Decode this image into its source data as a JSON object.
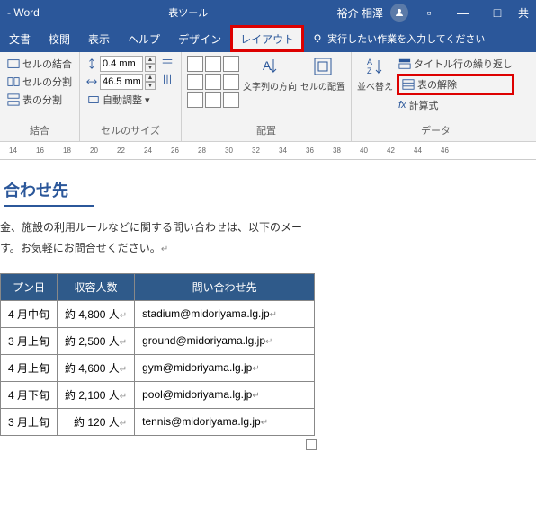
{
  "titlebar": {
    "app": "- Word",
    "context": "表ツール",
    "user": "裕介 相澤",
    "share": "共"
  },
  "tabs": {
    "items": [
      "文書",
      "校閲",
      "表示",
      "ヘルプ",
      "デザイン",
      "レイアウト"
    ],
    "tellme_placeholder": "実行したい作業を入力してください"
  },
  "ribbon": {
    "merge": {
      "combine": "セルの結合",
      "split": "セルの分割",
      "split_table": "表の分割",
      "label": "結合"
    },
    "size": {
      "height": "0.4 mm",
      "width": "46.5 mm",
      "autofit": "自動調整",
      "label": "セルのサイズ"
    },
    "align": {
      "text_dir": "文字列の方向",
      "cell_margin": "セルの配置",
      "label": "配置"
    },
    "data": {
      "sort": "並べ替え",
      "repeat_header": "タイトル行の繰り返し",
      "convert": "表の解除",
      "formula": "計算式",
      "label": "データ"
    }
  },
  "ruler": [
    "14",
    "16",
    "18",
    "20",
    "22",
    "24",
    "26",
    "28",
    "30",
    "32",
    "34",
    "36",
    "38",
    "40",
    "42",
    "44",
    "46"
  ],
  "doc": {
    "heading": "合わせ先",
    "para1": "金、施設の利用ルールなどに関する問い合わせは、以下のメー",
    "para2": "す。お気軽にお問合せください。",
    "headers": [
      "プン日",
      "収容人数",
      "問い合わせ先"
    ],
    "rows": [
      {
        "open": "4 月中旬",
        "cap": "約 4,800 人",
        "email": "stadium@midoriyama.lg.jp"
      },
      {
        "open": "3 月上旬",
        "cap": "約 2,500 人",
        "email": "ground@midoriyama.lg.jp"
      },
      {
        "open": "4 月上旬",
        "cap": "約 4,600 人",
        "email": "gym@midoriyama.lg.jp"
      },
      {
        "open": "4 月下旬",
        "cap": "約 2,100 人",
        "email": "pool@midoriyama.lg.jp"
      },
      {
        "open": "3 月上旬",
        "cap": "約 120 人",
        "email": "tennis@midoriyama.lg.jp"
      }
    ]
  }
}
